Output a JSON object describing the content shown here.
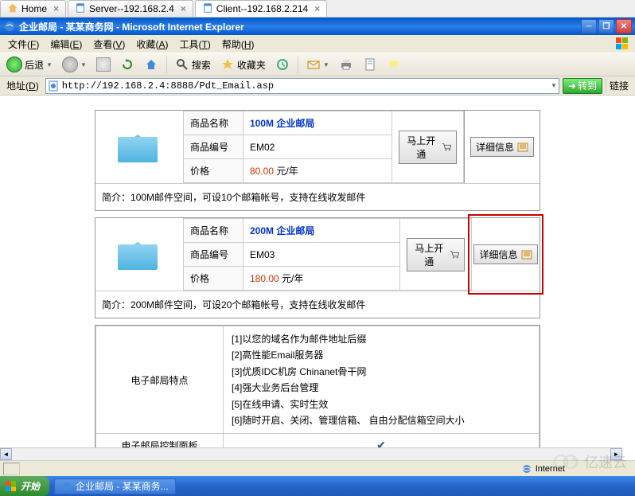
{
  "browser_tabs": [
    {
      "label": "Home",
      "icon": "home"
    },
    {
      "label": "Server--192.168.2.4",
      "icon": "page"
    },
    {
      "label": "Client--192.168.2.214",
      "icon": "page"
    }
  ],
  "ie": {
    "title": "企业邮局 - 某某商务网 - Microsoft Internet Explorer",
    "menu": {
      "file": "文件",
      "file_u": "F",
      "edit": "编辑",
      "edit_u": "E",
      "view": "查看",
      "view_u": "V",
      "fav": "收藏",
      "fav_u": "A",
      "tools": "工具",
      "tools_u": "T",
      "help": "帮助",
      "help_u": "H"
    },
    "toolbar": {
      "back": "后退",
      "search": "搜索",
      "favorites": "收藏夹"
    },
    "addr_label": "地址",
    "addr_u": "D",
    "url": "http://192.168.2.4:8888/Pdt_Email.asp",
    "go": "转到",
    "links": "链接"
  },
  "products": [
    {
      "name_label": "商品名称",
      "name_value": "100M 企业邮局",
      "code_label": "商品编号",
      "code_value": "EM02",
      "price_label": "价格",
      "price_value": "80.00",
      "price_unit": "元/年",
      "buy_btn": "马上开通",
      "detail_btn": "详细信息",
      "desc_label": "简介：",
      "desc_text": "100M邮件空间，可设10个邮箱帐号，支持在线收发邮件"
    },
    {
      "name_label": "商品名称",
      "name_value": "200M 企业邮局",
      "code_label": "商品编号",
      "code_value": "EM03",
      "price_label": "价格",
      "price_value": "180.00",
      "price_unit": "元/年",
      "buy_btn": "马上开通",
      "detail_btn": "详细信息",
      "desc_label": "简介：",
      "desc_text": "200M邮件空间，可设20个邮箱帐号，支持在线收发邮件"
    }
  ],
  "features": {
    "label": "电子邮局特点",
    "items": [
      "[1]以您的域名作为邮件地址后缀",
      "[2]高性能Email服务器",
      "[3]优质IDC机房 Chinanet骨干网",
      "[4]强大业务后台管理",
      "[5]在线申请、实时生效",
      "[6]随时开启、关闭、管理信箱、 自由分配信箱空间大小"
    ],
    "panel_label": "电子邮局控制面板"
  },
  "status": {
    "zone": "Internet"
  },
  "taskbar": {
    "start": "开始",
    "app": "企业邮局 - 某某商务..."
  },
  "watermark": "亿速云"
}
